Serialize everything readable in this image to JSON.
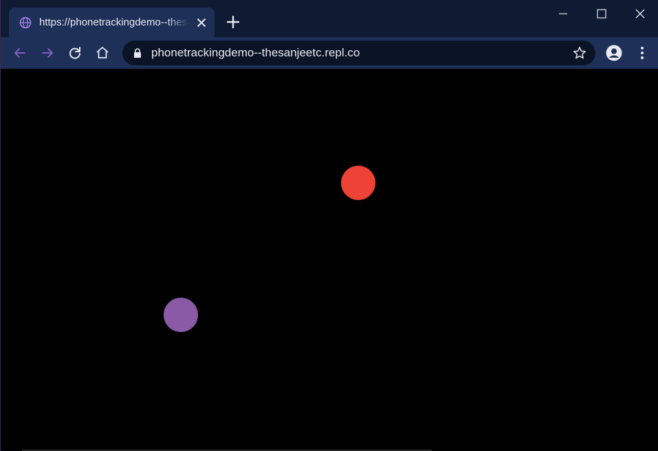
{
  "browser": {
    "tab": {
      "title": "https://phonetrackingdemo--thesanjeetc.repl.co",
      "favicon": "globe-icon"
    },
    "new_tab_icon": "plus-icon",
    "window_controls": [
      "minimize-icon",
      "maximize-icon",
      "close-icon"
    ],
    "toolbar": {
      "back_icon": "arrow-left-icon",
      "forward_icon": "arrow-right-icon",
      "reload_icon": "reload-icon",
      "home_icon": "home-icon",
      "url": "phonetrackingdemo--thesanjeetc.repl.co",
      "lock_icon": "lock-icon",
      "bookmark_icon": "star-icon",
      "profile_icon": "account-icon",
      "menu_icon": "kebab-menu-icon"
    },
    "colors": {
      "titlebar": "#0f1a33",
      "toolbar": "#1e3058",
      "accent": "#b084f0"
    }
  },
  "page": {
    "background": "#000000",
    "dots": [
      {
        "name": "red",
        "color": "#ef4236"
      },
      {
        "name": "purple",
        "color": "#8a5aa6"
      }
    ]
  }
}
